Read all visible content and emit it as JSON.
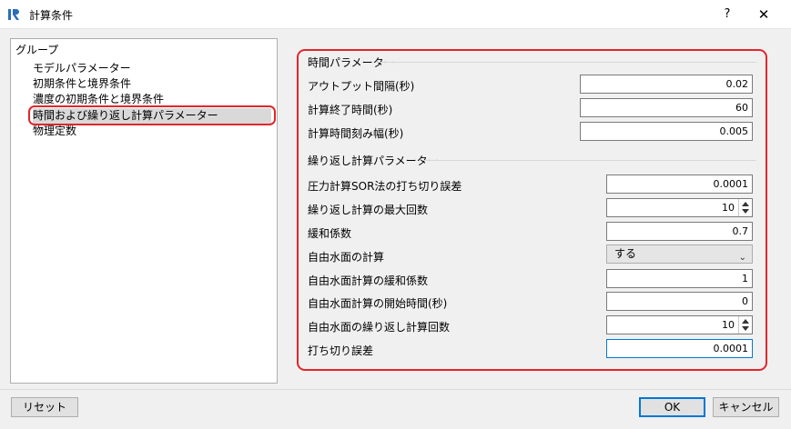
{
  "window": {
    "title": "計算条件",
    "help": "?",
    "close": "✕"
  },
  "group": {
    "label": "グループ",
    "items": [
      "モデルパラメーター",
      "初期条件と境界条件",
      "濃度の初期条件と境界条件",
      "時間および繰り返し計算パラメーター",
      "物理定数"
    ],
    "selected": "時間および繰り返し計算パラメーター"
  },
  "time_params": {
    "title": "時間パラメーター",
    "output_interval": {
      "label": "アウトプット間隔(秒)",
      "value": "0.02"
    },
    "end_time": {
      "label": "計算終了時間(秒)",
      "value": "60"
    },
    "time_step": {
      "label": "計算時間刻み幅(秒)",
      "value": "0.005"
    }
  },
  "iter_params": {
    "title": "繰り返し計算パラメーター",
    "sor_tolerance": {
      "label": "圧力計算SOR法の打ち切り誤差",
      "value": "0.0001"
    },
    "max_iterations": {
      "label": "繰り返し計算の最大回数",
      "value": "10"
    },
    "relaxation": {
      "label": "緩和係数",
      "value": "0.7"
    },
    "free_surface_calc": {
      "label": "自由水面の計算",
      "value": "する"
    },
    "free_surface_relaxation": {
      "label": "自由水面計算の緩和係数",
      "value": "1"
    },
    "free_surface_start": {
      "label": "自由水面計算の開始時間(秒)",
      "value": "0"
    },
    "free_surface_iterations": {
      "label": "自由水面の繰り返し計算回数",
      "value": "10"
    },
    "cutoff_error": {
      "label": "打ち切り誤差",
      "value": "0.0001"
    }
  },
  "buttons": {
    "reset": "リセット",
    "ok": "OK",
    "cancel": "キャンセル"
  },
  "colors": {
    "highlight": "#e2262b",
    "focus": "#0078d7"
  }
}
